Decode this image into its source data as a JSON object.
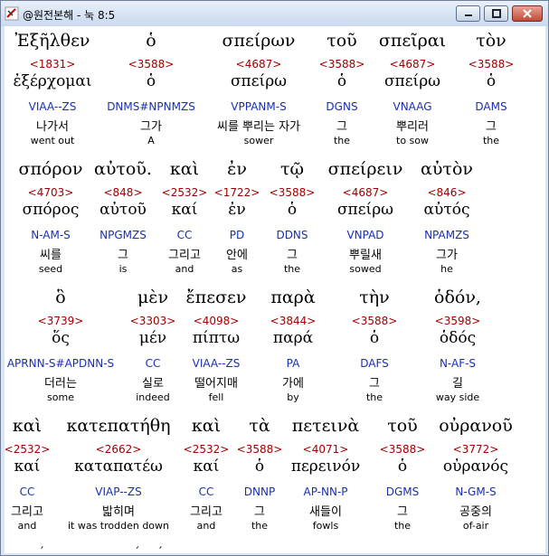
{
  "window": {
    "title": "@원전본해 - 눅 8:5"
  },
  "rows": [
    {
      "words": [
        {
          "greek": "Ἐξῆλθεν",
          "num": "<1831>",
          "lemma": "ἐξέρχομαι",
          "parse": "VIAA--ZS",
          "ko": "나가서",
          "en": "went out"
        },
        {
          "greek": "ὁ",
          "num": "<3588>",
          "lemma": "ὁ",
          "parse": "DNMS#NPNMZS",
          "ko": "그가",
          "en": "A"
        },
        {
          "greek": "σπείρων",
          "num": "<4687>",
          "lemma": "σπείρω",
          "parse": "VPPANM-S",
          "ko": "씨를 뿌리는 자가",
          "en": "sower"
        },
        {
          "greek": "τοῦ",
          "num": "<3588>",
          "lemma": "ὁ",
          "parse": "DGNS",
          "ko": "그",
          "en": "the"
        },
        {
          "greek": "σπεῖραι",
          "num": "<4687>",
          "lemma": "σπείρω",
          "parse": "VNAAG",
          "ko": "뿌리러",
          "en": "to sow"
        },
        {
          "greek": "τὸν",
          "num": "<3588>",
          "lemma": "ὁ",
          "parse": "DAMS",
          "ko": "그",
          "en": "the"
        }
      ]
    },
    {
      "words": [
        {
          "greek": "σπόρον",
          "num": "<4703>",
          "lemma": "σπόρος",
          "parse": "N-AM-S",
          "ko": "씨를",
          "en": "seed"
        },
        {
          "greek": "αὐτοῦ.",
          "num": "<848>",
          "lemma": "αὐτοῦ",
          "parse": "NPGMZS",
          "ko": "그",
          "en": "is"
        },
        {
          "greek": "καὶ",
          "num": "<2532>",
          "lemma": "καί",
          "parse": "CC",
          "ko": "그리고",
          "en": "and"
        },
        {
          "greek": "ἐν",
          "num": "<1722>",
          "lemma": "ἐν",
          "parse": "PD",
          "ko": "안에",
          "en": "as"
        },
        {
          "greek": "τῷ",
          "num": "<3588>",
          "lemma": "ὁ",
          "parse": "DDNS",
          "ko": "그",
          "en": "the"
        },
        {
          "greek": "σπείρειν",
          "num": "<4687>",
          "lemma": "σπείρω",
          "parse": "VNPAD",
          "ko": "뿌릴새",
          "en": "sowed"
        },
        {
          "greek": "αὐτὸν",
          "num": "<846>",
          "lemma": "αὐτός",
          "parse": "NPAMZS",
          "ko": "그가",
          "en": "he"
        }
      ]
    },
    {
      "words": [
        {
          "greek": "ὃ",
          "num": "<3739>",
          "lemma": "ὅς",
          "parse": "APRNN-S#APDNN-S",
          "ko": "더러는",
          "en": "some"
        },
        {
          "greek": "μὲν",
          "num": "<3303>",
          "lemma": "μέν",
          "parse": "CC",
          "ko": "실로",
          "en": "indeed"
        },
        {
          "greek": "ἔπεσεν",
          "num": "<4098>",
          "lemma": "πίπτω",
          "parse": "VIAA--ZS",
          "ko": "떨어지매",
          "en": "fell"
        },
        {
          "greek": "παρὰ",
          "num": "<3844>",
          "lemma": "παρά",
          "parse": "PA",
          "ko": "가에",
          "en": "by"
        },
        {
          "greek": "τὴν",
          "num": "<3588>",
          "lemma": "ὁ",
          "parse": "DAFS",
          "ko": "그",
          "en": "the"
        },
        {
          "greek": "ὁδόν,",
          "num": "<3598>",
          "lemma": "ὁδός",
          "parse": "N-AF-S",
          "ko": "길",
          "en": "way side"
        }
      ]
    },
    {
      "words": [
        {
          "greek": "καὶ",
          "num": "<2532>",
          "lemma": "καί",
          "parse": "CC",
          "ko": "그리고",
          "en": "and"
        },
        {
          "greek": "κατεπατήθη",
          "num": "<2662>",
          "lemma": "καταπατέω",
          "parse": "VIAP--ZS",
          "ko": "밟히며",
          "en": "it was trodden down"
        },
        {
          "greek": "καὶ",
          "num": "<2532>",
          "lemma": "καί",
          "parse": "CC",
          "ko": "그리고",
          "en": "and"
        },
        {
          "greek": "τὰ",
          "num": "<3588>",
          "lemma": "ὁ",
          "parse": "DNNP",
          "ko": "그",
          "en": "the"
        },
        {
          "greek": "πετεινὰ",
          "num": "<4071>",
          "lemma": "περεινόν",
          "parse": "AP-NN-P",
          "ko": "새들이",
          "en": "fowls"
        },
        {
          "greek": "τοῦ",
          "num": "<3588>",
          "lemma": "ὁ",
          "parse": "DGMS",
          "ko": "그",
          "en": "the"
        },
        {
          "greek": "οὐρανοῦ",
          "num": "<3772>",
          "lemma": "οὐρανός",
          "parse": "N-GM-S",
          "ko": "공중의",
          "en": "of-air"
        }
      ]
    }
  ]
}
